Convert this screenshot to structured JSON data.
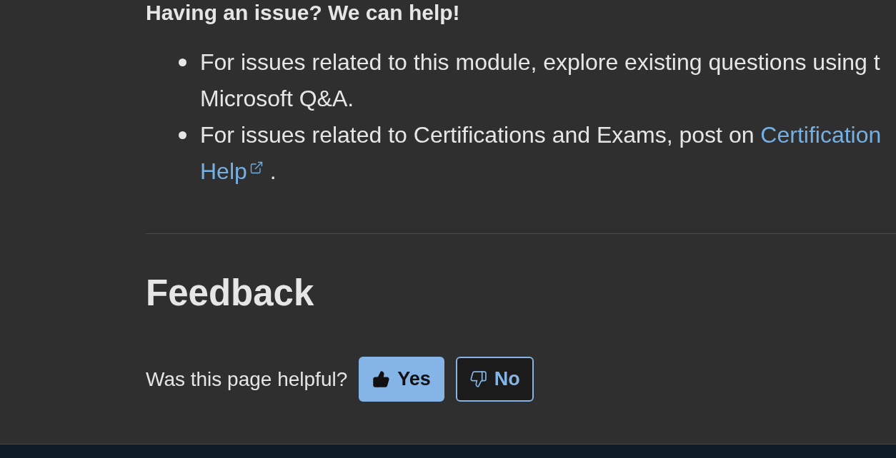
{
  "help_section": {
    "heading": "Having an issue? We can help!",
    "items": [
      {
        "lines": [
          [
            {
              "kind": "text",
              "text": "For issues related to this module, explore existing questions using t"
            }
          ],
          [
            {
              "kind": "text",
              "text": "Microsoft Q&A."
            }
          ]
        ]
      },
      {
        "lines": [
          [
            {
              "kind": "text",
              "text": "For issues related to Certifications and Exams, post on "
            },
            {
              "kind": "link",
              "text": "Certification"
            }
          ],
          [
            {
              "kind": "link",
              "text": "Help",
              "external": true
            },
            {
              "kind": "text",
              "text": " ."
            }
          ]
        ]
      }
    ]
  },
  "feedback": {
    "heading": "Feedback",
    "question": "Was this page helpful?",
    "buttons": [
      {
        "label": "Yes",
        "kind": "positive",
        "selected": true
      },
      {
        "label": "No",
        "kind": "negative",
        "selected": false
      }
    ]
  }
}
